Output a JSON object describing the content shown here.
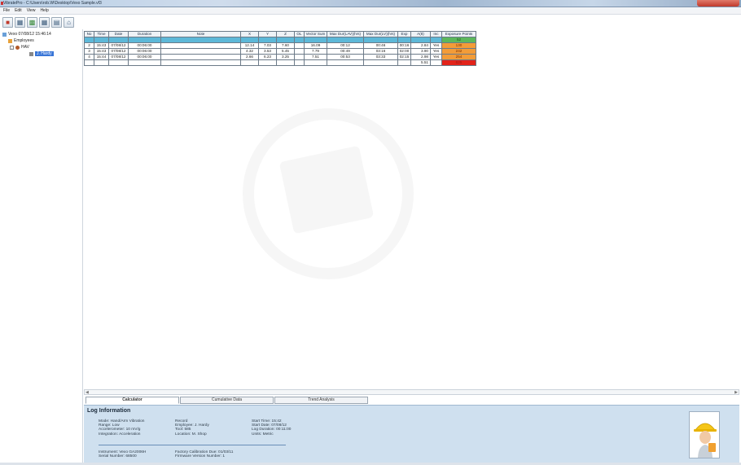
{
  "window": {
    "title": "VibratePro - C:\\Users\\rob.W\\Desktop\\Vexo Sample.vf3"
  },
  "menu": [
    "File",
    "Edit",
    "View",
    "Help"
  ],
  "toolbar": {
    "icons": [
      "open-icon",
      "save-icon",
      "export-icon",
      "grid-icon",
      "print-icon",
      "home-icon"
    ]
  },
  "tree": {
    "root": "Vexo 07/08/12 15:46:14",
    "employees": "Employees",
    "havs": "HAV",
    "employee": "J. Hardy"
  },
  "table": {
    "headers": [
      "No",
      "Time",
      "Date",
      "Duration",
      "Note",
      "X",
      "Y",
      "Z",
      "OL",
      "Vector Sum",
      "Max Dur(LAV)(hrs)",
      "Max Dur(LV)(hrs)",
      "Exp",
      "A(8)",
      "Inc",
      "Exposure Points"
    ],
    "rows": [
      [
        "2",
        "15:43",
        "07/08/12",
        "00:06:00",
        "",
        "12.14",
        "7.03",
        "7.60",
        "",
        "16.09",
        "00:12",
        "00:46",
        "00:16",
        "2.84",
        "Yes",
        "130"
      ],
      [
        "3",
        "15:43",
        "07/08/12",
        "00:06:00",
        "",
        "4.32",
        "3.53",
        "5.45",
        "",
        "7.79",
        "00:49",
        "03:16",
        "02:00",
        "3.90",
        "Yes",
        "242"
      ],
      [
        "4",
        "15:44",
        "07/08/12",
        "00:06:00",
        "",
        "2.66",
        "6.23",
        "3.25",
        "",
        "7.51",
        "00:53",
        "03:33",
        "02:15",
        "2.98",
        "Yes",
        "254"
      ],
      [
        "",
        "",
        "",
        "",
        "",
        "",
        "",
        "",
        "",
        "",
        "",
        "",
        "",
        "5.51",
        "",
        "625"
      ]
    ],
    "units_row_first_value": "52"
  },
  "tabs": [
    {
      "label": "Calculator",
      "active": true
    },
    {
      "label": "Cumulative Data",
      "active": false
    },
    {
      "label": "Trend Analysis",
      "active": false
    }
  ],
  "log": {
    "heading": "Log Information",
    "col1": [
      "Mode: Hand/Arm Vibration",
      "Range: Low",
      "Accelerometer: 10 mV/g",
      "Integration: Acceleration"
    ],
    "col2": [
      "Record",
      "Employee: J. Hardy",
      "Tool: 585",
      "Location: M. Shop"
    ],
    "col3": [
      "Start Time: 15:42",
      "Start Date: 07/08/12",
      "Log Duration: 00:11:00",
      "Units: Metric"
    ],
    "col4": [
      "Instrument: Vexo GA2006H",
      "Serial Number: 68500"
    ],
    "col5": [
      "Factory Calibration Due: 01/03/11",
      "Firmware Version Number: 1"
    ]
  },
  "colors": {
    "units_row": "#5db8d8",
    "green": "#5cb85c",
    "orange": "#f39c38",
    "red": "#e2231a",
    "log_panel": "#cfe0ef"
  }
}
